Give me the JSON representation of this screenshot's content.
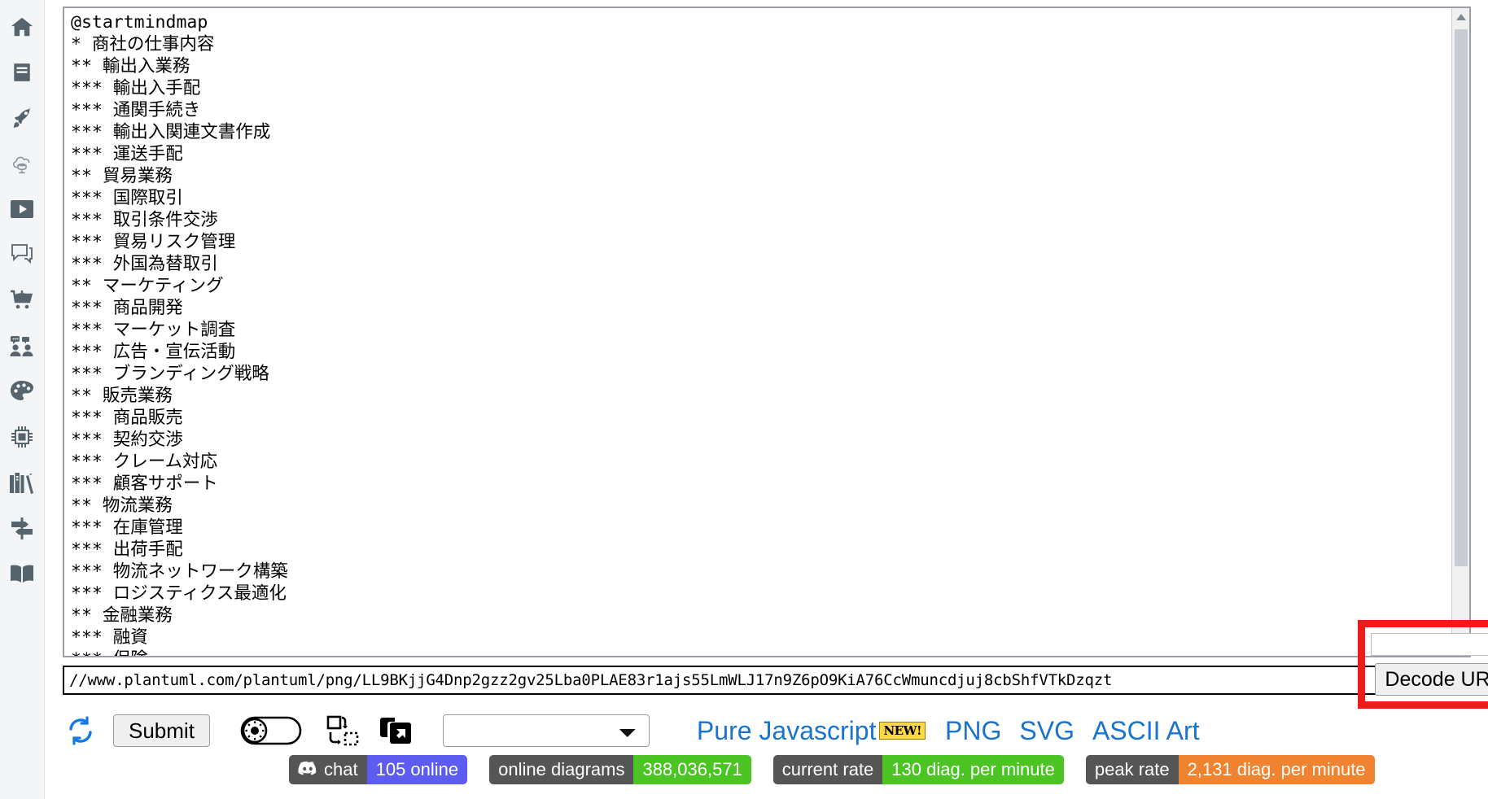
{
  "sidebar": {
    "items": [
      {
        "name": "home-icon",
        "label": "Home"
      },
      {
        "name": "document-icon",
        "label": "Documentation"
      },
      {
        "name": "rocket-icon",
        "label": "Quick start"
      },
      {
        "name": "cloud-db-icon",
        "label": "Server"
      },
      {
        "name": "video-play-icon",
        "label": "Videos"
      },
      {
        "name": "chat-bubble-icon",
        "label": "Forum"
      },
      {
        "name": "shopping-cart-download-icon",
        "label": "Download"
      },
      {
        "name": "community-icon",
        "label": "Community"
      },
      {
        "name": "palette-icon",
        "label": "Themes"
      },
      {
        "name": "chip-icon",
        "label": "Integration"
      },
      {
        "name": "books-icon",
        "label": "Books"
      },
      {
        "name": "signpost-icon",
        "label": "Roadmap"
      },
      {
        "name": "open-book-icon",
        "label": "Reference guide"
      }
    ]
  },
  "editor": {
    "content": "@startmindmap\n* 商社の仕事内容\n** 輸出入業務\n*** 輸出入手配\n*** 通関手続き\n*** 輸出入関連文書作成\n*** 運送手配\n** 貿易業務\n*** 国際取引\n*** 取引条件交渉\n*** 貿易リスク管理\n*** 外国為替取引\n** マーケティング\n*** 商品開発\n*** マーケット調査\n*** 広告・宣伝活動\n*** ブランディング戦略\n** 販売業務\n*** 商品販売\n*** 契約交渉\n*** クレーム対応\n*** 顧客サポート\n** 物流業務\n*** 在庫管理\n*** 出荷手配\n*** 物流ネットワーク構築\n*** ロジスティクス最適化\n** 金融業務\n*** 融資\n*** 保険",
    "scroll_up_icon": "triangle-up-icon",
    "scroll_down_icon": "triangle-down-icon"
  },
  "url_bar": {
    "value": "//www.plantuml.com/plantuml/png/LL9BKjjG4Dnp2gzz2gv25Lba0PLAE83r1ajs55LmWLJ17n9Z6pO9KiA76CcWmuncdjuj8cbShfVTkDzqzt",
    "placeholder": ""
  },
  "decode": {
    "button_label": "Decode URL",
    "select_value": "",
    "caret_icon": "caret-down-icon",
    "highlight_color": "#ee1b18"
  },
  "toolbar": {
    "refresh_icon": "refresh-icon",
    "submit_label": "Submit",
    "theme_toggle_icon": "dark-mode-toggle-icon",
    "resize_icon": "resize-diagram-icon",
    "copy_icon": "copy-to-clipboard-icon",
    "format_select_value": "",
    "format_select_options": [
      ""
    ],
    "links": [
      {
        "name": "pure-javascript-link",
        "label": "Pure Javascript",
        "badge": "NEW!"
      },
      {
        "name": "png-link",
        "label": "PNG"
      },
      {
        "name": "svg-link",
        "label": "SVG"
      },
      {
        "name": "ascii-art-link",
        "label": "ASCII Art"
      }
    ],
    "link_color": "#1a73cc"
  },
  "badges": [
    {
      "name": "discord-chat-badge",
      "icon": "discord-icon",
      "left": "chat",
      "right": "105 online",
      "right_color": "#5c5cf0"
    },
    {
      "name": "online-diagrams-badge",
      "icon": "",
      "left": "online diagrams",
      "right": "388,036,571",
      "right_color": "#4bc424"
    },
    {
      "name": "current-rate-badge",
      "icon": "",
      "left": "current rate",
      "right": "130 diag. per minute",
      "right_color": "#4bc424"
    },
    {
      "name": "peak-rate-badge",
      "icon": "",
      "left": "peak rate",
      "right": "2,131 diag. per minute",
      "right_color": "#f0832f"
    }
  ]
}
